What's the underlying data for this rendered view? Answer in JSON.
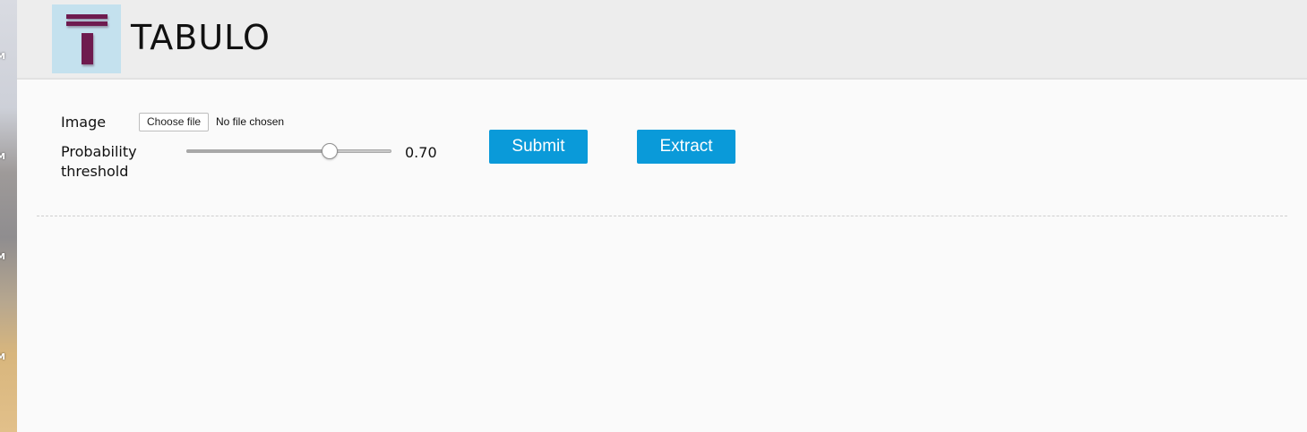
{
  "app": {
    "title": "TABULO",
    "logo_icon": "tabulo-logo-icon",
    "colors": {
      "header_bg": "#ededed",
      "logo_bg": "#c4e1ee",
      "logo_mark": "#6e1b4f",
      "button_bg": "#0a9ad9",
      "button_text": "#ffffff"
    }
  },
  "desktop": {
    "clipped_labels": [
      "M",
      "M",
      "M",
      "M"
    ]
  },
  "form": {
    "image_label": "Image",
    "file_button_label": "Choose file",
    "file_status": "No file chosen",
    "threshold_label": "Probability threshold",
    "threshold": {
      "value": 0.7,
      "display": "0.70",
      "min": 0,
      "max": 1
    },
    "submit_label": "Submit",
    "extract_label": "Extract"
  }
}
